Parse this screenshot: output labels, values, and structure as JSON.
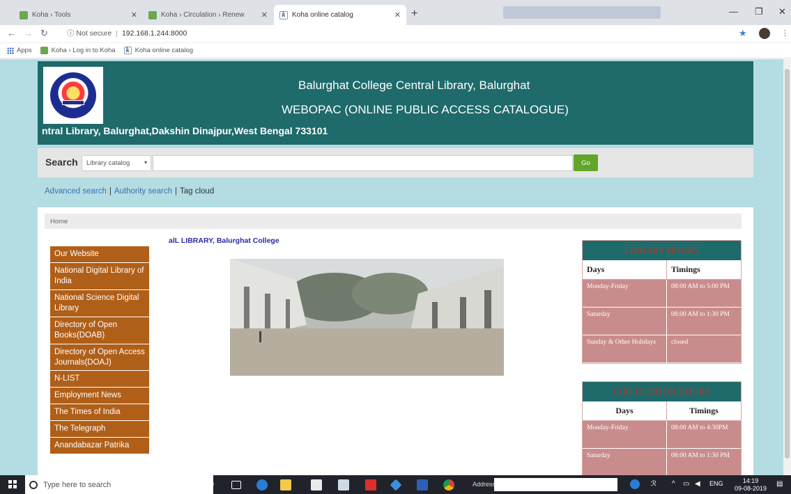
{
  "browser": {
    "tabs": [
      {
        "label": "Koha › Tools",
        "favicon": "koha-green-icon"
      },
      {
        "label": "Koha › Circulation › Renew",
        "favicon": "koha-green-icon"
      },
      {
        "label": "Koha online catalog",
        "favicon": "koha-k-icon"
      }
    ],
    "url_security": "Not secure",
    "url": "192.168.1.244:8000",
    "bookmarks": [
      {
        "label": "Apps"
      },
      {
        "label": "Koha › Log in to Koha"
      },
      {
        "label": "Koha online catalog"
      }
    ]
  },
  "header": {
    "college_name": "Balurghat College Central Library, Balurghat",
    "subtitle": "WEBOPAC (ONLINE PUBLIC ACCESS CATALOGUE)",
    "marquee": "ntral Library, Balurghat,Dakshin Dinajpur,West Bengal 733101"
  },
  "search": {
    "label": "Search",
    "catalog_option": "Library catalog",
    "go_label": "Go"
  },
  "links": {
    "advanced": "Advanced search",
    "authority": "Authority search",
    "tag_cloud": "Tag cloud"
  },
  "breadcrumb": "Home",
  "sidebar": [
    "Our Website",
    "National Digital Library of India",
    "National Science Digital Library",
    "Directory of Open Books(DOAB)",
    "Directory of Open Access Journals(DOAJ)",
    "N-LIST",
    "Employment News",
    "The Times of India",
    "The Telegraph",
    "Anandabazar Patrika"
  ],
  "notice": "alL LIBRARY, Balurghat College",
  "library_hours": {
    "title": "LIBRARY HOURS",
    "col_days": "Days",
    "col_timings": "Timings",
    "rows": [
      {
        "days": "Monday-Friday",
        "timings": "08:00 AM to 5:00 PM"
      },
      {
        "days": "Saturday",
        "timings": "08:00 AM to 1:30 PM"
      },
      {
        "days": "Sunday & Other Holidays",
        "timings": "closed"
      }
    ]
  },
  "circulation_hours": {
    "title": "CIRCULATION HOURS",
    "col_days": "Days",
    "col_timings": "Timings",
    "rows": [
      {
        "days": "Monday-Friday",
        "timings": "08:00 AM to 4:30PM"
      },
      {
        "days": "Saturday",
        "timings": "08:00 AM to 1:30 PM"
      }
    ]
  },
  "taskbar": {
    "search_placeholder": "Type here to search",
    "address_label": "Address",
    "lang": "ENG",
    "time": "14:19",
    "date": "09-08-2019"
  },
  "colors": {
    "header_teal": "#1f6a6b",
    "page_bg": "#b3dde2",
    "sidebar_brown": "#b05f18",
    "hours_rose": "#c98c8c",
    "go_green": "#63a528"
  }
}
